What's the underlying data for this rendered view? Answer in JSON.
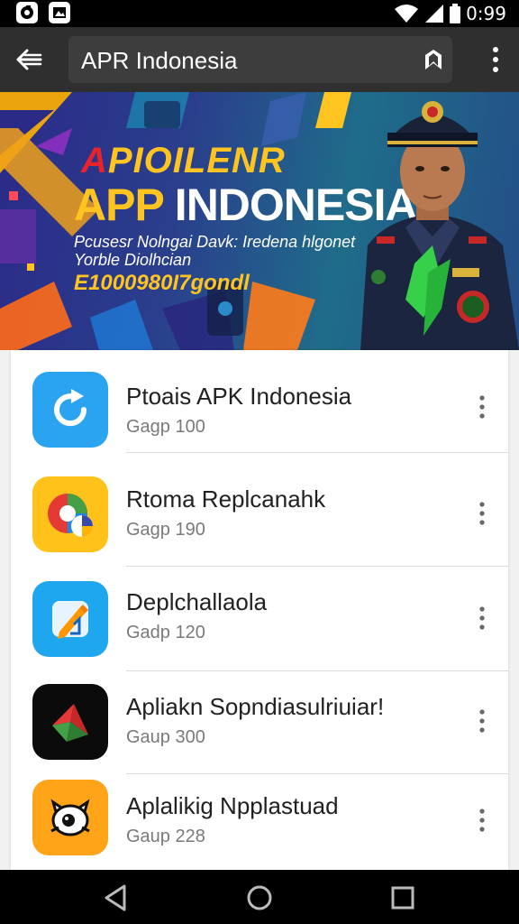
{
  "status_bar": {
    "time": "0:99",
    "icons": [
      "app-notification-icon",
      "photo-notification-icon",
      "wifi-icon",
      "signal-icon",
      "battery-icon"
    ]
  },
  "toolbar": {
    "title": "APR Indonesia",
    "icons": [
      "back-arrow-icon",
      "bookmark-icon",
      "more-vert-icon"
    ]
  },
  "banner": {
    "title_line1_accent": "A",
    "title_line1_rest": "PIOILENR",
    "title_line2_main": "APP ",
    "title_line2_end": "INDONESIA",
    "subtitle_line1": "Pcusesr Nolngai Davk: Iredena hlgonet",
    "subtitle_line2": "Yorble Diolhcian",
    "code": "E1000980I7gondl"
  },
  "apps": [
    {
      "name": "Ptoais APK Indonesia",
      "size": "Gagp 100",
      "icon": "refresh-icon",
      "icon_bg": "#2aa3f0"
    },
    {
      "name": "Rtoma Replcanahk",
      "size": "Gagp 190",
      "icon": "globe-browser-icon",
      "icon_bg": "#ffc21a"
    },
    {
      "name": "Deplchallaola",
      "size": "Gadp 120",
      "icon": "pencil-edit-icon",
      "icon_bg": "#1ea7ef"
    },
    {
      "name": "Apliakn Sopndiasulriuiar!",
      "size": "Gaup 300",
      "icon": "arrow-shape-icon",
      "icon_bg": "#0b0b0b"
    },
    {
      "name": "Aplalikig Npplastuad",
      "size": "Gaup 228",
      "icon": "cat-face-icon",
      "icon_bg": "#ffa318"
    }
  ],
  "nav_bar": {
    "icons": [
      "back-triangle-icon",
      "home-circle-icon",
      "recents-square-icon"
    ]
  },
  "colors": {
    "toolbar_bg": "#2f2f2f",
    "banner_accent_yellow": "#ffc41f",
    "banner_accent_red": "#e8242b"
  }
}
